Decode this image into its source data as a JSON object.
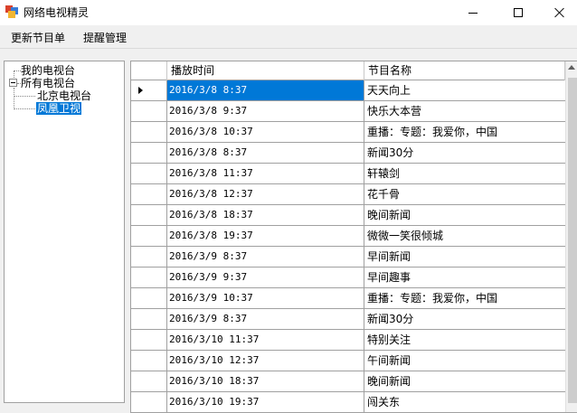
{
  "window": {
    "title": "网络电视精灵",
    "minimize_label": "",
    "maximize_label": "",
    "close_label": ""
  },
  "menu": {
    "items": [
      "更新节目单",
      "提醒管理"
    ]
  },
  "tree": {
    "nodes": [
      {
        "label": "我的电视台",
        "level": 0
      },
      {
        "label": "所有电视台",
        "level": 0,
        "expanded": true
      },
      {
        "label": "北京电视台",
        "level": 1
      },
      {
        "label": "凤凰卫视",
        "level": 1,
        "selected": true
      }
    ]
  },
  "grid": {
    "columns": [
      "播放时间",
      "节目名称"
    ],
    "rows": [
      {
        "time": "2016/3/8 8:37",
        "name": "天天向上",
        "current": true
      },
      {
        "time": "2016/3/8 9:37",
        "name": "快乐大本营"
      },
      {
        "time": "2016/3/8 10:37",
        "name": "重播：专题：我爱你，中国"
      },
      {
        "time": "2016/3/8 8:37",
        "name": "新闻30分"
      },
      {
        "time": "2016/3/8 11:37",
        "name": "轩辕剑"
      },
      {
        "time": "2016/3/8 12:37",
        "name": "花千骨"
      },
      {
        "time": "2016/3/8 18:37",
        "name": "晚间新闻"
      },
      {
        "time": "2016/3/8 19:37",
        "name": "微微一笑很倾城"
      },
      {
        "time": "2016/3/9 8:37",
        "name": "早间新闻"
      },
      {
        "time": "2016/3/9 9:37",
        "name": "早间趣事"
      },
      {
        "time": "2016/3/9 10:37",
        "name": "重播：专题：我爱你，中国"
      },
      {
        "time": "2016/3/9 8:37",
        "name": "新闻30分"
      },
      {
        "time": "2016/3/10 11:37",
        "name": "特别关注"
      },
      {
        "time": "2016/3/10 12:37",
        "name": "午间新闻"
      },
      {
        "time": "2016/3/10 18:37",
        "name": "晚间新闻"
      },
      {
        "time": "2016/3/10 19:37",
        "name": "闯关东"
      }
    ]
  },
  "colors": {
    "selection": "#0078d7",
    "gridline": "#a0a0a0",
    "background": "#f0f0f0"
  }
}
